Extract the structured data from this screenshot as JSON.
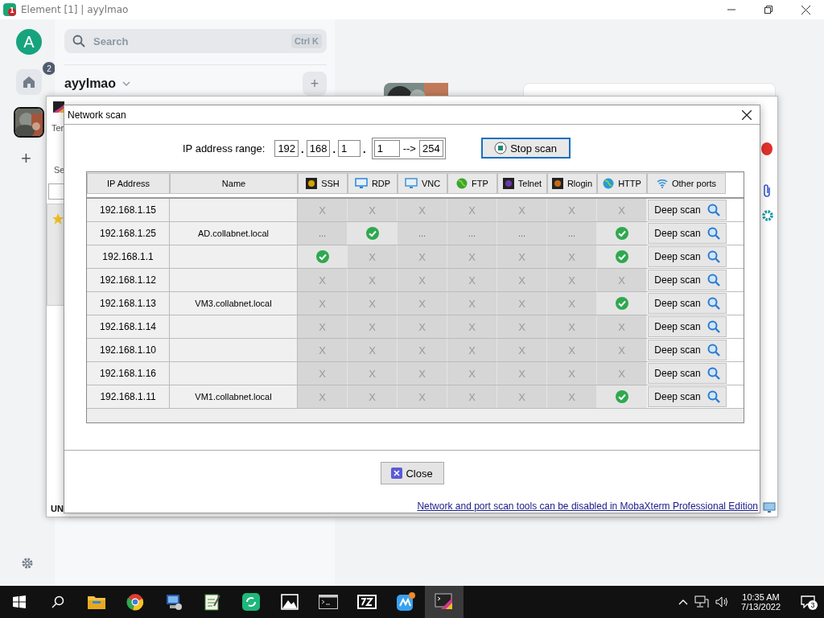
{
  "window": {
    "title": "Element [1] | ayylmao",
    "app_badge": "1"
  },
  "rail": {
    "avatar": "A",
    "home_badge": "2",
    "add": "+"
  },
  "sidebar": {
    "search": {
      "placeholder": "Search",
      "shortcut": "Ctrl K"
    },
    "space": "ayylmao",
    "add": "+"
  },
  "back_window": {
    "fragments": [
      "Ter",
      "Se",
      "UN"
    ]
  },
  "dialog": {
    "title": "Network scan",
    "range": {
      "label": "IP address range:",
      "octets": [
        "192",
        "168",
        "1"
      ],
      "separator": ".",
      "from": "1",
      "arrow": "-->",
      "to": "254"
    },
    "stop_button": "Stop scan",
    "columns": [
      {
        "label": "IP Address",
        "kind": "text"
      },
      {
        "label": "Name",
        "kind": "text"
      },
      {
        "label": "SSH",
        "kind": "ssh"
      },
      {
        "label": "RDP",
        "kind": "rdp"
      },
      {
        "label": "VNC",
        "kind": "vnc"
      },
      {
        "label": "FTP",
        "kind": "ftp"
      },
      {
        "label": "Telnet",
        "kind": "telnet"
      },
      {
        "label": "Rlogin",
        "kind": "rlogin"
      },
      {
        "label": "HTTP",
        "kind": "http"
      },
      {
        "label": "Other ports",
        "kind": "wifi"
      }
    ],
    "rows": [
      {
        "ip": "192.168.1.15",
        "name": "",
        "ports": [
          {
            "kind": "closed",
            "text": "X"
          },
          {
            "kind": "closed",
            "text": "X"
          },
          {
            "kind": "closed",
            "text": "X"
          },
          {
            "kind": "closed",
            "text": "X"
          },
          {
            "kind": "closed",
            "text": "X"
          },
          {
            "kind": "closed",
            "text": "X"
          },
          {
            "kind": "closed",
            "text": "X"
          }
        ],
        "action": "Deep scan"
      },
      {
        "ip": "192.168.1.25",
        "name": "AD.collabnet.local",
        "ports": [
          {
            "kind": "pending",
            "text": "..."
          },
          {
            "kind": "open"
          },
          {
            "kind": "pending",
            "text": "..."
          },
          {
            "kind": "pending",
            "text": "..."
          },
          {
            "kind": "pending",
            "text": "..."
          },
          {
            "kind": "pending",
            "text": "..."
          },
          {
            "kind": "open"
          }
        ],
        "action": "Deep scan"
      },
      {
        "ip": "192.168.1.1",
        "name": "",
        "ports": [
          {
            "kind": "open"
          },
          {
            "kind": "closed",
            "text": "X"
          },
          {
            "kind": "closed",
            "text": "X"
          },
          {
            "kind": "closed",
            "text": "X"
          },
          {
            "kind": "closed",
            "text": "X"
          },
          {
            "kind": "closed",
            "text": "X"
          },
          {
            "kind": "open"
          }
        ],
        "action": "Deep scan"
      },
      {
        "ip": "192.168.1.12",
        "name": "",
        "ports": [
          {
            "kind": "closed",
            "text": "X"
          },
          {
            "kind": "closed",
            "text": "X"
          },
          {
            "kind": "closed",
            "text": "X"
          },
          {
            "kind": "closed",
            "text": "X"
          },
          {
            "kind": "closed",
            "text": "X"
          },
          {
            "kind": "closed",
            "text": "X"
          },
          {
            "kind": "closed",
            "text": "X"
          }
        ],
        "action": "Deep scan"
      },
      {
        "ip": "192.168.1.13",
        "name": "VM3.collabnet.local",
        "ports": [
          {
            "kind": "closed",
            "text": "X"
          },
          {
            "kind": "closed",
            "text": "X"
          },
          {
            "kind": "closed",
            "text": "X"
          },
          {
            "kind": "closed",
            "text": "X"
          },
          {
            "kind": "closed",
            "text": "X"
          },
          {
            "kind": "closed",
            "text": "X"
          },
          {
            "kind": "open"
          }
        ],
        "action": "Deep scan"
      },
      {
        "ip": "192.168.1.14",
        "name": "",
        "ports": [
          {
            "kind": "closed",
            "text": "X"
          },
          {
            "kind": "closed",
            "text": "X"
          },
          {
            "kind": "closed",
            "text": "X"
          },
          {
            "kind": "closed",
            "text": "X"
          },
          {
            "kind": "closed",
            "text": "X"
          },
          {
            "kind": "closed",
            "text": "X"
          },
          {
            "kind": "closed",
            "text": "X"
          }
        ],
        "action": "Deep scan"
      },
      {
        "ip": "192.168.1.10",
        "name": "",
        "ports": [
          {
            "kind": "closed",
            "text": "X"
          },
          {
            "kind": "closed",
            "text": "X"
          },
          {
            "kind": "closed",
            "text": "X"
          },
          {
            "kind": "closed",
            "text": "X"
          },
          {
            "kind": "closed",
            "text": "X"
          },
          {
            "kind": "closed",
            "text": "X"
          },
          {
            "kind": "closed",
            "text": "X"
          }
        ],
        "action": "Deep scan"
      },
      {
        "ip": "192.168.1.16",
        "name": "",
        "ports": [
          {
            "kind": "closed",
            "text": "X"
          },
          {
            "kind": "closed",
            "text": "X"
          },
          {
            "kind": "closed",
            "text": "X"
          },
          {
            "kind": "closed",
            "text": "X"
          },
          {
            "kind": "closed",
            "text": "X"
          },
          {
            "kind": "closed",
            "text": "X"
          },
          {
            "kind": "closed",
            "text": "X"
          }
        ],
        "action": "Deep scan"
      },
      {
        "ip": "192.168.1.11",
        "name": "VM1.collabnet.local",
        "ports": [
          {
            "kind": "closed",
            "text": "X"
          },
          {
            "kind": "closed",
            "text": "X"
          },
          {
            "kind": "closed",
            "text": "X"
          },
          {
            "kind": "closed",
            "text": "X"
          },
          {
            "kind": "closed",
            "text": "X"
          },
          {
            "kind": "closed",
            "text": "X"
          },
          {
            "kind": "open"
          }
        ],
        "action": "Deep scan"
      }
    ],
    "close_button": "Close",
    "footer_link": "Network and port scan tools can be disabled in MobaXterm Professional Edition"
  },
  "taskbar": {
    "time": "10:35 AM",
    "date": "7/13/2022",
    "notifications": "3"
  }
}
